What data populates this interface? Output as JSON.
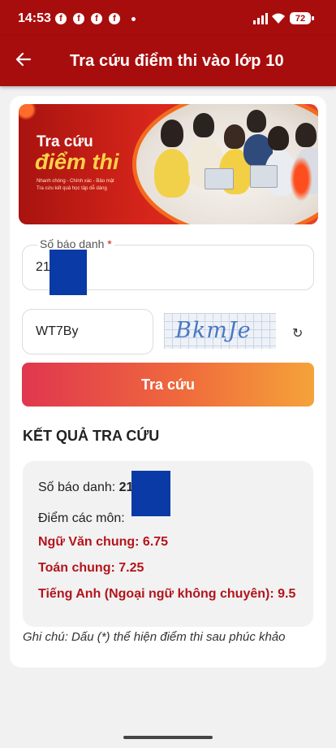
{
  "status_bar": {
    "time": "14:53",
    "battery": "72",
    "notification_icons": [
      "facebook-icon",
      "facebook-icon",
      "facebook-icon",
      "facebook-icon"
    ]
  },
  "app_bar": {
    "title": "Tra cứu điểm thi vào lớp 10",
    "back_icon": "arrow-left-icon"
  },
  "banner": {
    "title_line1": "Tra cứu",
    "title_line2": "điểm thi",
    "tagline1": "Nhanh chóng - Chính xác - Bảo mật",
    "tagline2": "Tra cứu kết quả học tập dễ dàng"
  },
  "form": {
    "sbd_label": "Số báo danh",
    "required_mark": "*",
    "sbd_value": "21",
    "captcha_input": "WT7By",
    "captcha_image_text": "BkmJe",
    "refresh_icon": "refresh-icon",
    "submit_label": "Tra cứu"
  },
  "result": {
    "heading": "KẾT QUẢ TRA CỨU",
    "sbd_label": "Số báo danh:",
    "sbd_value": "21",
    "scores_label": "Điểm các môn:",
    "subjects": [
      "Ngữ Văn chung: 6.75",
      "Toán chung: 7.25",
      "Tiếng Anh (Ngoại ngữ không chuyên): 9.5"
    ],
    "note": "Ghi chú: Dấu (*) thể hiện điểm thi sau phúc khảo"
  },
  "colors": {
    "primary": "#a80d0d",
    "score_text": "#b3141b",
    "button_start": "#e0364f",
    "button_end": "#f5a33a"
  }
}
